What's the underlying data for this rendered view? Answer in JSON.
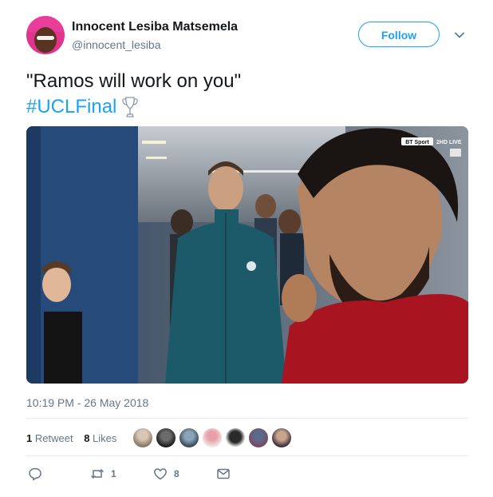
{
  "author": {
    "display_name": "Innocent Lesiba Matsemela",
    "handle": "@innocent_lesiba",
    "avatar_icon": "user-avatar"
  },
  "follow_label": "Follow",
  "tweet": {
    "text": "\"Ramos will work on you\"",
    "hashtag": "#UCLFinal",
    "emoji_icon": "trophy-icon"
  },
  "media": {
    "broadcaster": "BT Sport",
    "channel_tag": "2HD LIVE"
  },
  "timestamp": "10:19 PM - 26 May 2018",
  "stats": {
    "retweets_count": "1",
    "retweets_label": "Retweet",
    "likes_count": "8",
    "likes_label": "Likes"
  },
  "actions": {
    "reply_icon": "reply-icon",
    "retweet_icon": "retweet-icon",
    "retweet_count": "1",
    "like_icon": "heart-icon",
    "like_count": "8",
    "dm_icon": "envelope-icon"
  },
  "colors": {
    "link_blue": "#1da1f2",
    "secondary_text": "#657786",
    "divider": "#e6ecf0"
  }
}
